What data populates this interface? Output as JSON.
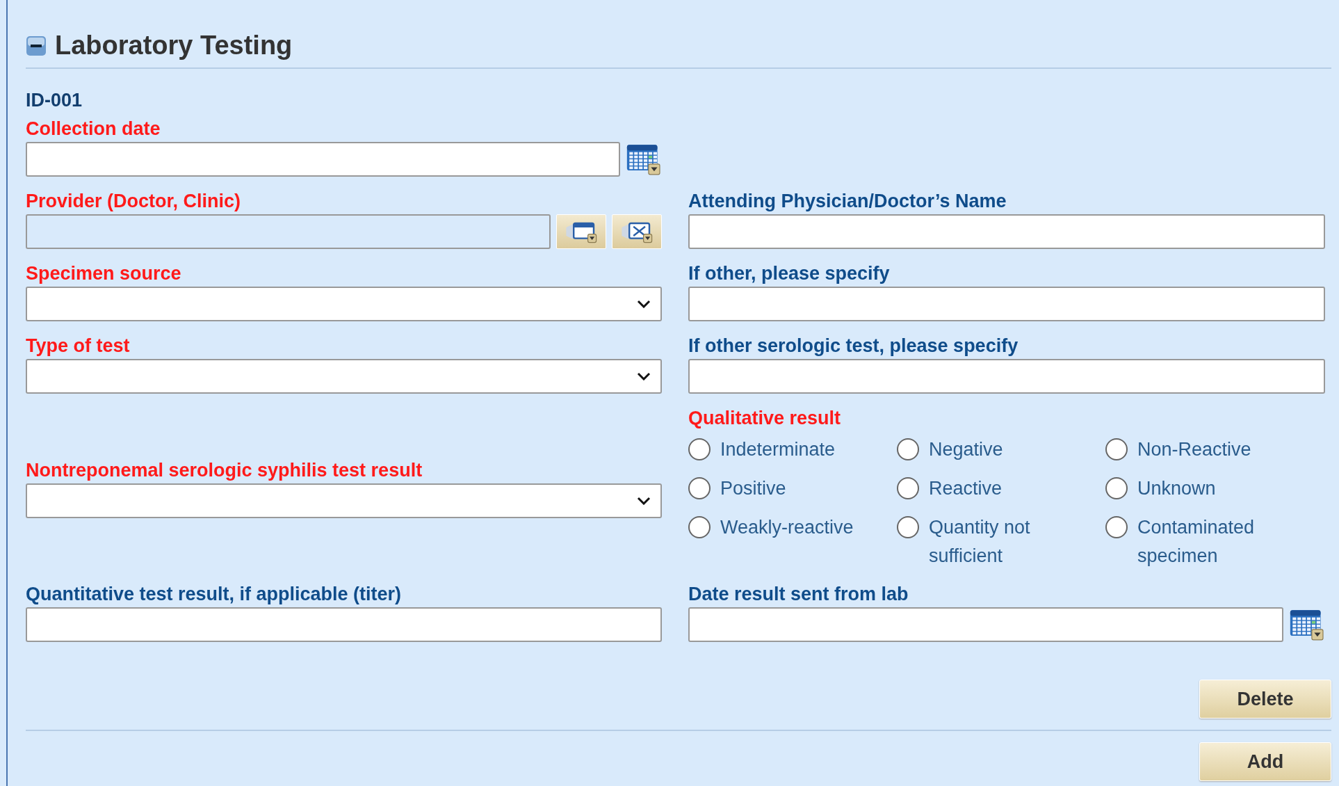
{
  "section": {
    "title": "Laboratory Testing",
    "expanded": true
  },
  "record_id": "ID-001",
  "rows": [
    {
      "left": {
        "kind": "date",
        "label": "Collection date",
        "required": true
      },
      "right": null
    },
    {
      "left": {
        "kind": "lookup",
        "label": "Provider (Doctor, Clinic)",
        "required": true,
        "disabled": true
      },
      "right": {
        "kind": "text",
        "label": "Attending Physician/Doctor’s Name",
        "required": false
      }
    },
    {
      "left": {
        "kind": "select",
        "label": "Specimen source",
        "required": true
      },
      "right": {
        "kind": "text",
        "label": "If other, please specify",
        "required": false
      }
    },
    {
      "left": {
        "kind": "select",
        "label": "Type of test",
        "required": true
      },
      "right": {
        "kind": "text",
        "label": "If other serologic test, please specify",
        "required": false
      }
    },
    {
      "left": {
        "kind": "select",
        "label": "Nontreponemal serologic syphilis test result",
        "required": true
      },
      "right": {
        "kind": "radio",
        "label": "Qualitative result",
        "required": true,
        "options": [
          {
            "label": "Indeterminate",
            "selected": false
          },
          {
            "label": "Negative",
            "selected": false
          },
          {
            "label": "Non-Reactive",
            "selected": false
          },
          {
            "label": "Positive",
            "selected": false
          },
          {
            "label": "Reactive",
            "selected": false
          },
          {
            "label": "Unknown",
            "selected": false
          },
          {
            "label": "Weakly-reactive",
            "selected": false
          },
          {
            "label": "Quantity not sufficient",
            "selected": false
          },
          {
            "label": "Contaminated specimen",
            "selected": false
          }
        ]
      }
    },
    {
      "left": {
        "kind": "text",
        "label": "Quantitative test result, if applicable (titer)",
        "required": false
      },
      "right": {
        "kind": "date",
        "label": "Date result sent from lab",
        "required": false
      }
    }
  ],
  "buttons": [
    {
      "label": "Delete"
    },
    {
      "label": "Add"
    }
  ]
}
